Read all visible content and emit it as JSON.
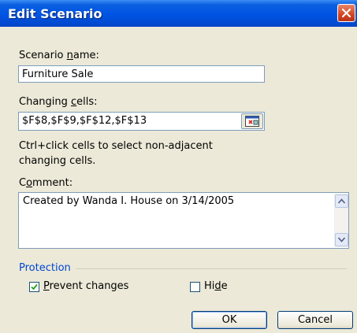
{
  "window": {
    "title": "Edit Scenario"
  },
  "scenario_name": {
    "label_prefix": "Scenario ",
    "label_accel": "n",
    "label_suffix": "ame:",
    "value": "Furniture Sale"
  },
  "changing_cells": {
    "label_prefix": "Changing ",
    "label_accel": "c",
    "label_suffix": "ells:",
    "value": "$F$8,$F$9,$F$12,$F$13"
  },
  "hint": {
    "line1": "Ctrl+click cells to select non-adjacent",
    "line2": "changing cells."
  },
  "comment": {
    "label_prefix": "C",
    "label_accel": "o",
    "label_suffix": "mment:",
    "value": "Created by Wanda I. House on 3/14/2005"
  },
  "protection": {
    "title": "Protection",
    "prevent_changes": {
      "label_accel": "P",
      "label_rest": "revent changes",
      "checked": true
    },
    "hide": {
      "label_prefix": "Hi",
      "label_accel": "d",
      "label_suffix": "e",
      "checked": false
    }
  },
  "buttons": {
    "ok": "OK",
    "cancel": "Cancel"
  },
  "colors": {
    "titlebar": "#0054e3",
    "dialog_bg": "#ece9d8",
    "group_title": "#0046d5",
    "close_button": "#d4441f",
    "checkmark": "#21a121"
  },
  "icons": {
    "close": "close-icon",
    "collapse": "collapse-dialog-icon",
    "scroll_up": "arrow-up-icon",
    "scroll_down": "arrow-down-icon",
    "check": "checkmark-icon"
  }
}
